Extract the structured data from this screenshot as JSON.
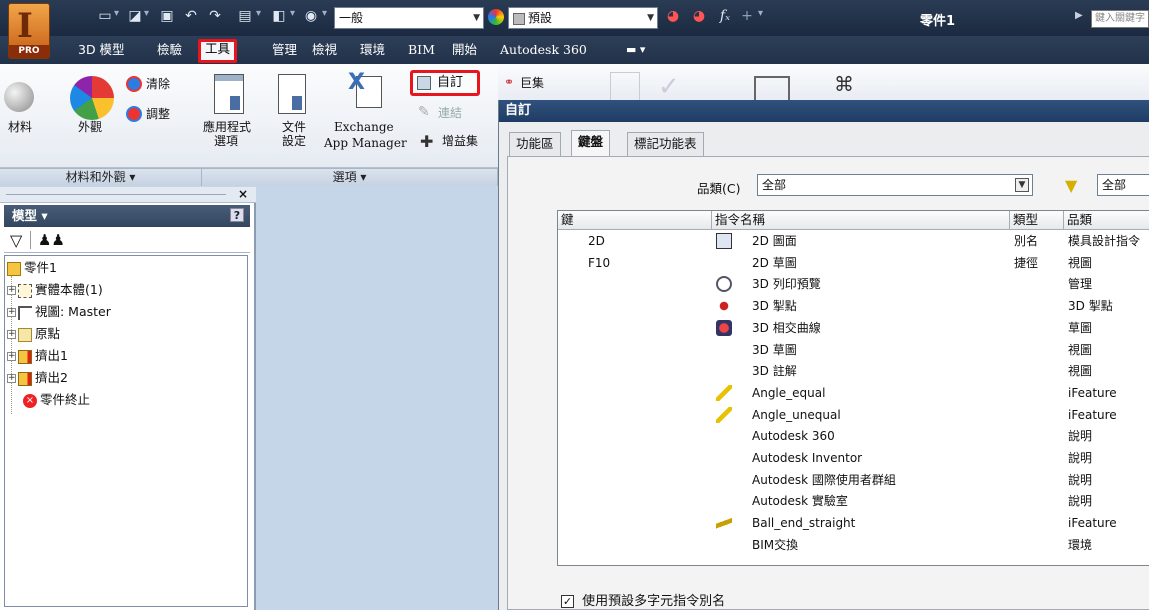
{
  "app": {
    "logo_text": "I",
    "edition": "PRO",
    "document_title": "零件1",
    "search_placeholder": "鍵入關鍵字"
  },
  "qat": {
    "style_combo": "一般",
    "appearance_combo": "預設"
  },
  "menu": {
    "tabs": [
      "3D 模型",
      "檢驗",
      "工具",
      "管理",
      "檢視",
      "環境",
      "BIM",
      "開始",
      "Autodesk 360"
    ],
    "active": "工具"
  },
  "ribbon": {
    "material": "材料",
    "appearance": "外觀",
    "clear": "清除",
    "adjust": "調整",
    "app_options_1": "應用程式",
    "app_options_2": "選項",
    "doc_settings_1": "文件",
    "doc_settings_2": "設定",
    "exchange_1": "Exchange",
    "exchange_2": "App Manager",
    "customize": "自訂",
    "link": "連結",
    "add_ins": "增益集",
    "macros": "巨集",
    "panel_material_appearance": "材料和外觀 ▾",
    "panel_options": "選項 ▾"
  },
  "browser": {
    "title": "模型 ▾",
    "help": "?",
    "close": "×",
    "tree": [
      {
        "label": "零件1"
      },
      {
        "label": "實體本體(1)"
      },
      {
        "label": "視圖: Master"
      },
      {
        "label": "原點"
      },
      {
        "label": "擠出1"
      },
      {
        "label": "擠出2"
      },
      {
        "label": "零件終止"
      }
    ]
  },
  "dialog": {
    "title": "自訂",
    "tabs": [
      "功能區",
      "鍵盤",
      "標記功能表"
    ],
    "active_tab": "鍵盤",
    "category_label": "品類(C)",
    "category_value": "全部",
    "filter_value": "全部",
    "columns": [
      "鍵",
      "指令名稱",
      "類型",
      "品類"
    ],
    "rows": [
      {
        "key": "2D",
        "command": "2D 圖面",
        "type": "別名",
        "category": "模具設計指令"
      },
      {
        "key": "F10",
        "command": "2D 草圖",
        "type": "捷徑",
        "category": "視圖"
      },
      {
        "key": "",
        "command": "3D 列印預覽",
        "type": "",
        "category": "管理"
      },
      {
        "key": "",
        "command": "3D 掣點",
        "type": "",
        "category": "3D 掣點"
      },
      {
        "key": "",
        "command": "3D 相交曲線",
        "type": "",
        "category": "草圖"
      },
      {
        "key": "",
        "command": "3D 草圖",
        "type": "",
        "category": "視圖"
      },
      {
        "key": "",
        "command": "3D 註解",
        "type": "",
        "category": "視圖"
      },
      {
        "key": "",
        "command": "Angle_equal",
        "type": "",
        "category": "iFeature"
      },
      {
        "key": "",
        "command": "Angle_unequal",
        "type": "",
        "category": "iFeature"
      },
      {
        "key": "",
        "command": "Autodesk 360",
        "type": "",
        "category": "說明"
      },
      {
        "key": "",
        "command": "Autodesk Inventor",
        "type": "",
        "category": "說明"
      },
      {
        "key": "",
        "command": "Autodesk 國際使用者群組",
        "type": "",
        "category": "說明"
      },
      {
        "key": "",
        "command": "Autodesk 實驗室",
        "type": "",
        "category": "說明"
      },
      {
        "key": "",
        "command": "Ball_end_straight",
        "type": "",
        "category": "iFeature"
      },
      {
        "key": "",
        "command": "BIM交換",
        "type": "",
        "category": "環境"
      }
    ],
    "checkbox_label": "使用預設多字元指令別名",
    "checkbox_checked": "✓"
  }
}
